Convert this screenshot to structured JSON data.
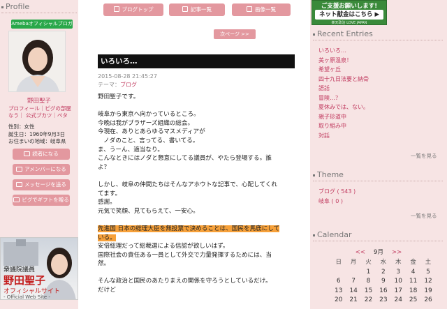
{
  "left": {
    "profile_heading": "Profile",
    "ameba_badge": "Amebaオフィシャルブロガー",
    "name": "野田聖子",
    "links": "プロフィール｜ピグの部屋なう｜ 公式プカツ｜ペタ",
    "info": [
      "性別：女性",
      "誕生日：1960年9月3日",
      "お住まいの地域：岐阜県"
    ],
    "buttons": [
      "読者になる",
      "アメンバーになる",
      "メッセージを送る",
      "ピグでギフトを贈る"
    ],
    "banner": {
      "line1": "衆議院議員",
      "line2": "野田聖子",
      "line3": "オフィシャルサイト",
      "line4": "- Official Web Site -"
    }
  },
  "center": {
    "top_buttons": [
      "ブログトップ",
      "記事一覧",
      "画像一覧"
    ],
    "next": "次ページ >>",
    "entry": {
      "title": "いろいろ…",
      "date": "2015-08-28 21:45:27",
      "theme_label": "テーマ：",
      "theme_link": "ブログ",
      "body": [
        "野田聖子です。",
        "",
        "岐阜から東京へ向かっているところ。",
        "今晩は我がブラザーズ組織の総会。",
        "今現在、ありとあらゆるマスメディアが",
        "ノダのこと、言ってる、書いてる。",
        "ま、うーん、適当なり。",
        "こんなときにはノダと懇意にしてる議員が、やたら登場する。誰",
        "よ？",
        "",
        "しかし、岐阜の仲間たちはそんなアホウトな記事で、心配してくれ",
        "てます。",
        "感謝。",
        "元気で笑顔、見てもらえて、一安心。",
        ""
      ],
      "highlight": [
        "先進国 日本の総理大臣を無投票で決めることは、国民を馬鹿にして",
        "いる。"
      ],
      "body_after": [
        "安倍総理だって総裁選による信認が欲しいはず。",
        "国際社会の責任ある一員として外交で力量発揮するためには、当",
        "然。",
        "",
        "そんな政治と国民のあたりまえの関係を守ろうとしているだけ。",
        "だけど"
      ]
    }
  },
  "right": {
    "support": {
      "line1": "ご支援お願いします!",
      "line2": "ネット献金はこちら ▶",
      "line3": "楽天政治 LOVE JAPAN"
    },
    "recent_heading": "Recent Entries",
    "recent": [
      "いろいろ…",
      "美ヶ原温泉！",
      "希望ヶ丘",
      "四十九日法要と納骨",
      "語話",
      "冒険…？",
      "夏休みでは、ない。",
      "親子珍道中",
      "取り組み中",
      "対話"
    ],
    "more": "一覧を見る",
    "theme_heading": "Theme",
    "themes": [
      "ブログ ( 543 )",
      "岐阜 ( 0 )"
    ],
    "calendar_heading": "Calendar",
    "calendar": {
      "prev": "<<",
      "month": "9月",
      "next": ">>",
      "weekdays": [
        "日",
        "月",
        "火",
        "水",
        "木",
        "金",
        "土"
      ],
      "rows": [
        [
          "",
          "",
          "1",
          "2",
          "3",
          "4",
          "5"
        ],
        [
          "6",
          "7",
          "8",
          "9",
          "10",
          "11",
          "12"
        ],
        [
          "13",
          "14",
          "15",
          "16",
          "17",
          "18",
          "19"
        ],
        [
          "20",
          "21",
          "22",
          "23",
          "24",
          "25",
          "26"
        ]
      ]
    }
  }
}
